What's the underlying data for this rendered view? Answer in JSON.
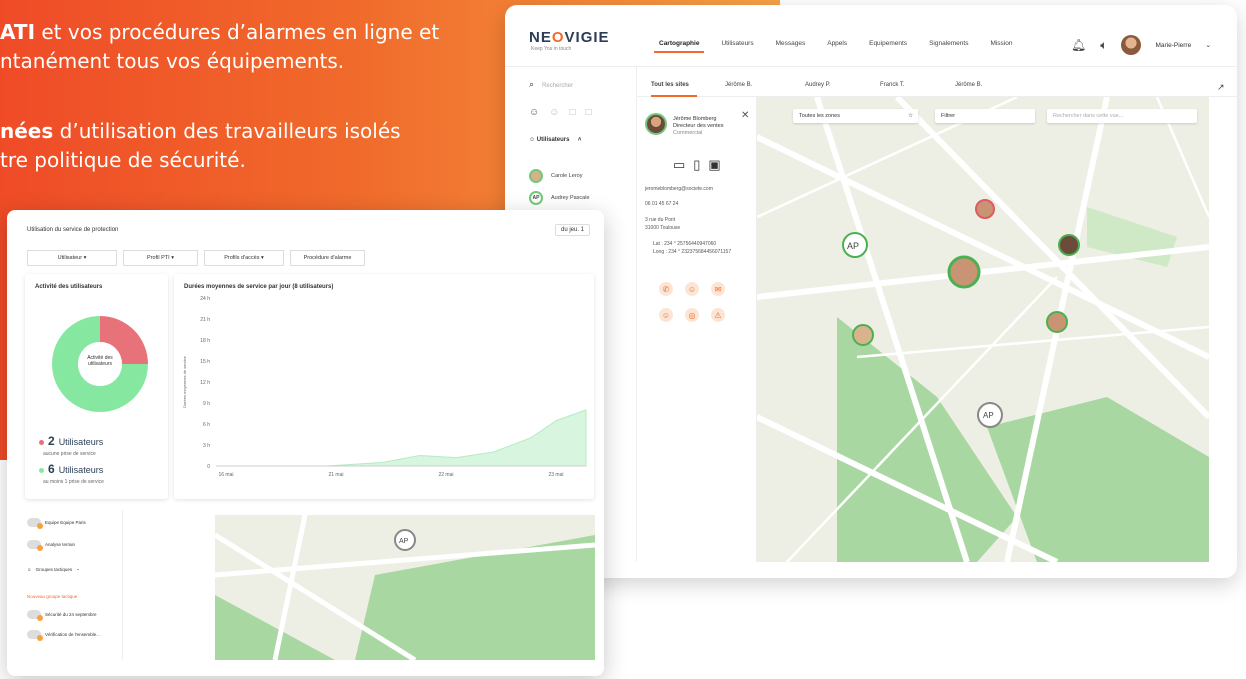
{
  "hero": {
    "line1_bold": "ATI",
    "line1_rest": " et vos procédures d’alarmes en ligne et",
    "line2": "ntanément tous vos équipements.",
    "line3_bold": "nées",
    "line3_rest": " d’utilisation des travailleurs isolés",
    "line4": "tre politique de sécurité."
  },
  "app": {
    "logo_a": "NE",
    "logo_o": "O",
    "logo_b": "VIGIE",
    "tagline": "Keep You in touch",
    "nav": [
      "Cartographie",
      "Utilisateurs",
      "Messages",
      "Appels",
      "Equipements",
      "Signalements",
      "Mission"
    ],
    "user_name": "Marie-Pierre",
    "search_placeholder": "Rechercher",
    "sidebar_section": "Utilisateurs",
    "sidebar_users": [
      {
        "initials": "",
        "name": "Carole Leroy"
      },
      {
        "initials": "AP",
        "name": "Audrey Pascale"
      }
    ],
    "tabs": [
      "Tout les sites",
      "Jérôme B.",
      "Audrey P.",
      "Franck T.",
      "Jérôme B."
    ],
    "panel": {
      "name": "Jérôme Blomberg",
      "role1": "Directeur des ventes",
      "role2": "Commercial",
      "email": "jeromeblomberg@societe.com",
      "phone": "06 01 45 67 24",
      "address1": "3 rue du Pont",
      "address2": "31000 Toulouse",
      "lat": "Lat : 234 ° 25756440947060",
      "long": "Long : 234 ° 232375684456071157"
    },
    "map_filters": {
      "zones": "Toutes les zones",
      "filter": "Filtrer",
      "search": "Rechercher dans cette vue..."
    }
  },
  "analytics": {
    "title": "Utilisation du service de protection",
    "period": "du jeu. 1",
    "filters": [
      "Utilisateur ▾",
      "Profil PTI ▾",
      "Profils d'accès ▾",
      "Procédure d'alarme"
    ],
    "activity_title": "Activité des utilisateurs",
    "donut_label_1": "Activité des",
    "donut_label_2": "utilisateurs",
    "legend": [
      {
        "count": "2",
        "label": "Utilisateurs",
        "sub": "aucune prise de service",
        "color": "#e8727a"
      },
      {
        "count": "6",
        "label": "Utilisateurs",
        "sub": "au moins 1 prise de service",
        "color": "#86e8a0"
      }
    ],
    "duration_title": "Durées moyennes de service par jour (8 utilisateurs)",
    "side_rows": [
      "Equipe Equipe Paris",
      "Analyse terrain",
      "Groupes tactiques",
      "Nouveau groupe tactique",
      "Sécurité du 24 septembre",
      "Vérification de l'ensemble..."
    ]
  },
  "chart_data": {
    "type": "area",
    "title": "Durées moyennes de service par jour (8 utilisateurs)",
    "ylabel": "Durées moyennes de service",
    "y_ticks": [
      "0",
      "3 h",
      "6 h",
      "9 h",
      "12 h",
      "15 h",
      "18 h",
      "21 h",
      "24 h"
    ],
    "ylim": [
      0,
      24
    ],
    "x_ticks": [
      "16 mai",
      "21 mai",
      "22 mai",
      "23 mai"
    ],
    "x_index": [
      0,
      0.15,
      0.3,
      0.45,
      0.55,
      0.65,
      0.75,
      0.85,
      0.92,
      1.0
    ],
    "values": [
      0,
      0,
      0,
      0.5,
      1.5,
      1.2,
      2,
      4,
      6.5,
      8
    ],
    "fill_color": "#d8f5df",
    "line_color": "#b5ebc2"
  },
  "donut": {
    "type": "pie",
    "values": [
      2,
      6
    ],
    "colors": [
      "#e8727a",
      "#86e8a0"
    ]
  }
}
